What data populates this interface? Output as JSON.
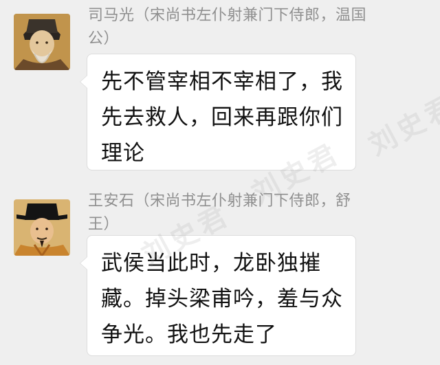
{
  "messages": [
    {
      "sender": "司马光（宋尚书左仆射兼门下侍郎，温国公）",
      "text": "先不管宰相不宰相了，我先去救人，回来再跟你们理论",
      "avatar_icon": "portrait-avatar-icon"
    },
    {
      "sender": "王安石（宋尚书左仆射兼门下侍郎，舒王）",
      "text": "武侯当此时，龙卧独摧藏。掉头梁甫吟，羞与众争光。我也先走了",
      "avatar_icon": "portrait-avatar-icon"
    }
  ],
  "watermark": "刘史君"
}
